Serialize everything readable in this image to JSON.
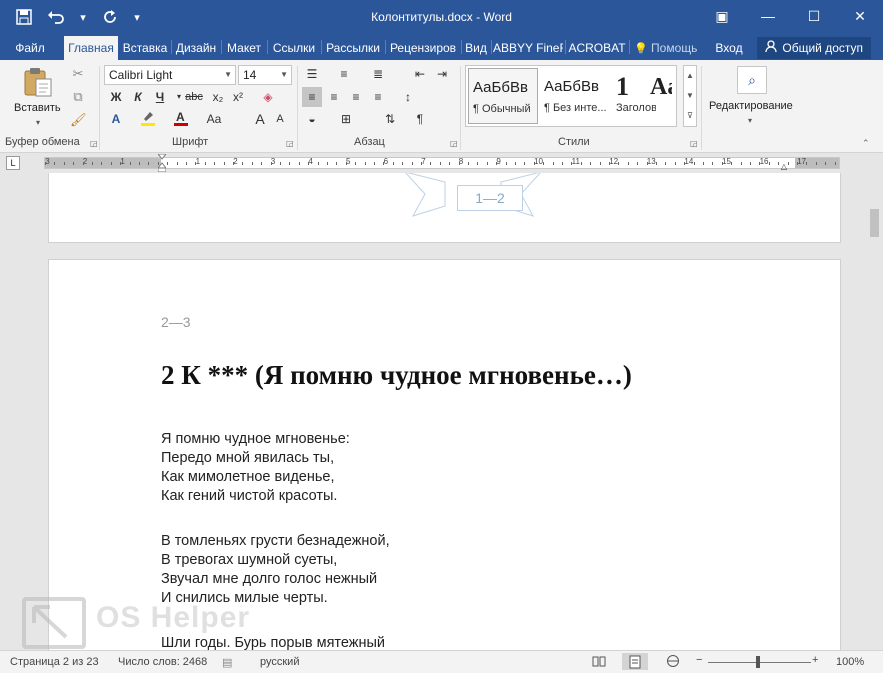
{
  "window": {
    "title": "Колонтитулы.docx - Word",
    "controls": {
      "ribbon_display": "▣",
      "minimize": "—",
      "maximize": "☐",
      "close": "✕"
    }
  },
  "qat": {
    "save": "💾",
    "undo": "↶",
    "undo_dd": "▾",
    "redo": "↻",
    "customize": "▾"
  },
  "tabs": [
    "Файл",
    "Главная",
    "Вставка",
    "Дизайн",
    "Макет",
    "Ссылки",
    "Рассылки",
    "Рецензиров",
    "Вид",
    "ABBYY FineF",
    "ACROBAT",
    "Помощь",
    "Вход"
  ],
  "tab_help_icon": "💡",
  "share": {
    "label": "Общий доступ",
    "icon": "👤"
  },
  "ribbon": {
    "clipboard": {
      "paste_label": "Вставить",
      "group_label": "Буфер обмена",
      "dropdown": "▾"
    },
    "font": {
      "font_name": "Calibri Light",
      "font_size": "14",
      "group_label": "Шрифт",
      "bold": "Ж",
      "italic": "К",
      "underline": "Ч",
      "strike": "abc",
      "subscript": "x₂",
      "superscript": "x²",
      "grow": "A",
      "shrink": "A",
      "case": "Aa"
    },
    "paragraph": {
      "group_label": "Абзац",
      "pilcrow": "¶"
    },
    "styles": {
      "group_label": "Стили",
      "items": [
        {
          "sample": "АаБбВв",
          "name": "¶ Обычный"
        },
        {
          "sample": "АаБбВв",
          "name": "¶ Без инте..."
        },
        {
          "sample": "1",
          "name": "Заголово..."
        },
        {
          "sample": "Aa",
          "name": ""
        }
      ]
    },
    "editing": {
      "label": "Редактирование",
      "dropdown": "▾"
    }
  },
  "ruler": {
    "numbers": [
      "3",
      "2",
      "1",
      "1",
      "2",
      "3",
      "4",
      "5",
      "6",
      "7",
      "8",
      "9",
      "10",
      "11",
      "12",
      "13",
      "14",
      "15",
      "16",
      "17"
    ]
  },
  "document": {
    "prev_page_footer": "1—2",
    "header": "2—3",
    "heading": "2  К *** (Я помню чудное мгновенье…)",
    "stanzas": [
      [
        "Я помню чудное мгновенье:",
        "Передо мной явилась ты,",
        "Как мимолетное виденье,",
        "Как гений чистой красоты."
      ],
      [
        "В томленьях грусти безнадежной,",
        "В тревогах шумной суеты,",
        "Звучал мне долго голос нежный",
        "И снились милые черты."
      ],
      [
        "Шли годы. Бурь порыв мятежный"
      ]
    ]
  },
  "watermark": {
    "text": "OS Helper"
  },
  "statusbar": {
    "page": "Страница 2 из 23",
    "words": "Число слов: 2468",
    "language": "русский",
    "zoom": "100%",
    "zoom_minus": "−",
    "zoom_plus": "+"
  }
}
